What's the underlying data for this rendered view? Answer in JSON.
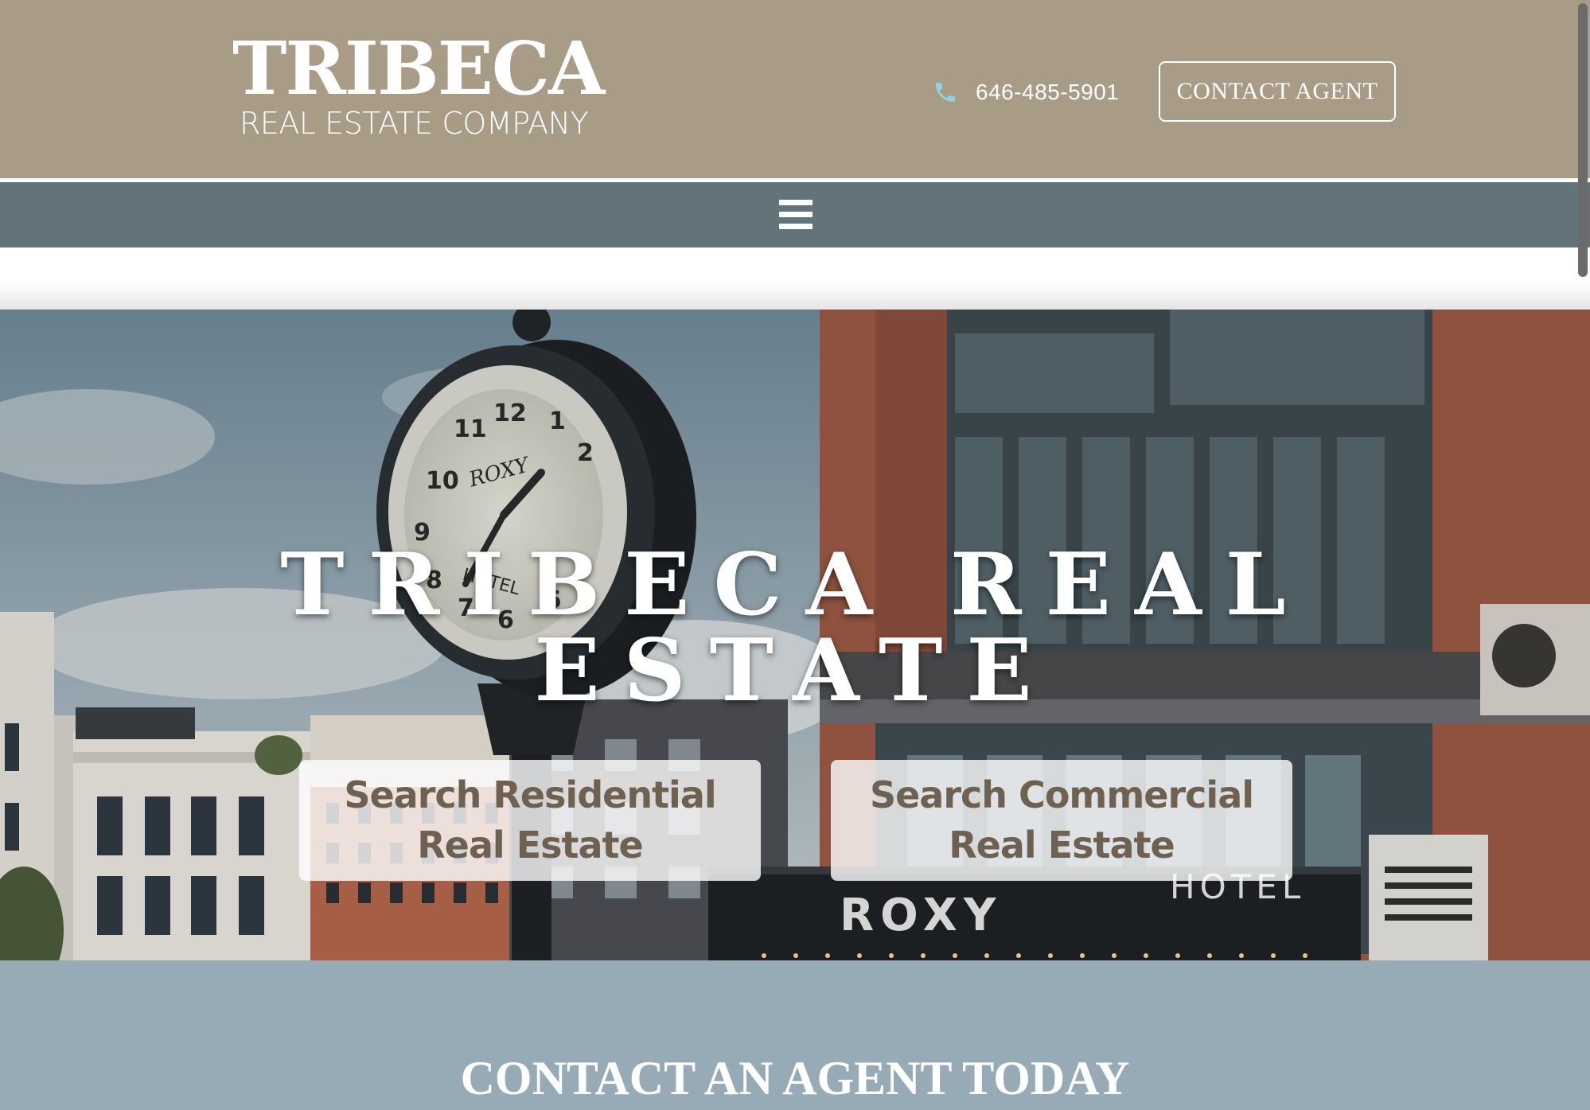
{
  "header": {
    "logo": {
      "main": "TRIBECA",
      "sub": "REAL ESTATE COMPANY"
    },
    "phone": "646-485-5901",
    "contact_button": "CONTACT AGENT",
    "icons": {
      "phone": "phone-icon",
      "menu": "hamburger-menu-icon"
    }
  },
  "hero": {
    "title": "TRIBECA REAL ESTATE",
    "search_residential": "Search Residential\nReal Estate",
    "search_commercial": "Search Commercial\nReal Estate",
    "clock_brand": "ROXY",
    "clock_sub": "HOTEL",
    "marquee_left": "ROXY",
    "marquee_right": "HOTEL"
  },
  "contact_section": {
    "heading": "CONTACT AN AGENT TODAY"
  },
  "colors": {
    "header_bg": "#a99c87",
    "nav_bg": "#62747a",
    "contact_bg": "#97abb6",
    "button_text": "#6e6151",
    "phone_icon": "#8fd3e0"
  }
}
